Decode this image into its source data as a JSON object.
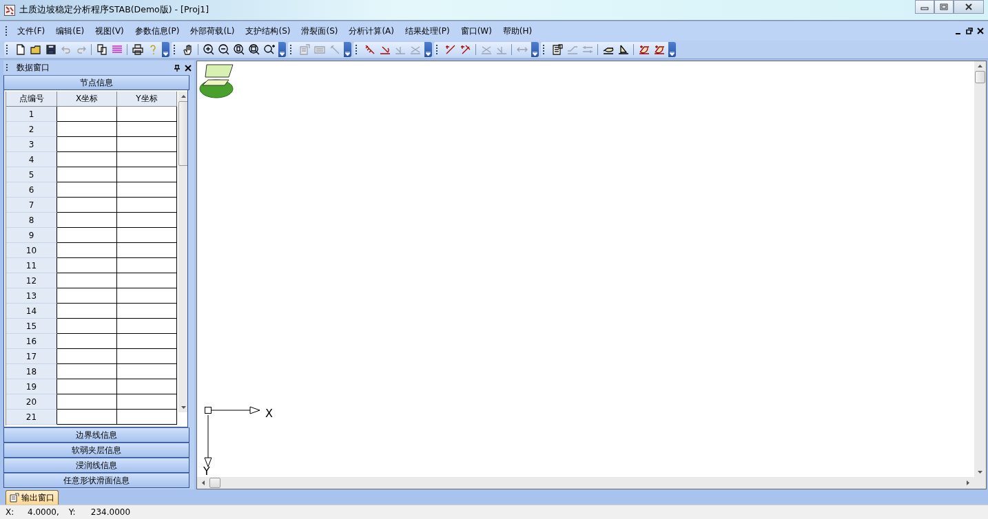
{
  "window": {
    "title": "土质边坡稳定分析程序STAB(Demo版) - [Proj1]"
  },
  "menu": [
    "文件(F)",
    "编辑(E)",
    "视图(V)",
    "参数信息(P)",
    "外部荷载(L)",
    "支护结构(S)",
    "滑裂面(S)",
    "分析计算(A)",
    "结果处理(P)",
    "窗口(W)",
    "帮助(H)"
  ],
  "toolbar_groups": [
    [
      {
        "kind": "new",
        "disabled": false
      },
      {
        "kind": "open",
        "disabled": false
      },
      {
        "kind": "save",
        "disabled": false
      },
      {
        "kind": "undo",
        "disabled": true
      },
      {
        "kind": "redo",
        "disabled": true
      },
      {
        "kind": "separator"
      },
      {
        "kind": "copy",
        "disabled": false
      },
      {
        "kind": "colors",
        "disabled": false
      },
      {
        "kind": "separator"
      },
      {
        "kind": "print",
        "disabled": false
      },
      {
        "kind": "help",
        "disabled": false
      }
    ],
    [
      {
        "kind": "hand",
        "disabled": false
      },
      {
        "kind": "separator"
      },
      {
        "kind": "zoom-in",
        "disabled": false
      },
      {
        "kind": "zoom-out",
        "disabled": false
      },
      {
        "kind": "zoom-page",
        "disabled": false
      },
      {
        "kind": "zoom-window",
        "disabled": false
      },
      {
        "kind": "zoom-plus",
        "disabled": false
      }
    ],
    [
      {
        "kind": "properties",
        "disabled": true
      },
      {
        "kind": "keyboard",
        "disabled": true
      },
      {
        "kind": "tool",
        "disabled": true
      }
    ],
    [
      {
        "kind": "hatch",
        "disabled": false
      },
      {
        "kind": "rotate",
        "disabled": false
      },
      {
        "kind": "tick-line",
        "disabled": true
      },
      {
        "kind": "cross-line",
        "disabled": true
      }
    ],
    [
      {
        "kind": "plus-line",
        "disabled": false
      },
      {
        "kind": "plus-anchor",
        "disabled": false
      },
      {
        "kind": "separator"
      },
      {
        "kind": "cross-line",
        "disabled": true
      },
      {
        "kind": "tick-line",
        "disabled": true
      },
      {
        "kind": "separator"
      },
      {
        "kind": "arrows",
        "disabled": true
      }
    ],
    [
      {
        "kind": "table",
        "disabled": false
      },
      {
        "kind": "slope",
        "disabled": true
      },
      {
        "kind": "measure",
        "disabled": true
      },
      {
        "kind": "separator"
      },
      {
        "kind": "slope-ellipse",
        "disabled": false
      },
      {
        "kind": "slope-triangle",
        "disabled": false
      },
      {
        "kind": "separator"
      },
      {
        "kind": "slip-curve",
        "disabled": false
      },
      {
        "kind": "slip-curve",
        "disabled": false
      }
    ]
  ],
  "data_window": {
    "title": "数据窗口",
    "sections": [
      {
        "title": "节点信息",
        "expanded": true
      },
      {
        "title": "边界线信息",
        "expanded": false
      },
      {
        "title": "软弱夹层信息",
        "expanded": false
      },
      {
        "title": "浸润线信息",
        "expanded": false
      },
      {
        "title": "任意形状滑面信息",
        "expanded": false
      }
    ],
    "table": {
      "columns": [
        "点编号",
        "X坐标",
        "Y坐标"
      ],
      "rows": [
        "1",
        "2",
        "3",
        "4",
        "5",
        "6",
        "7",
        "8",
        "9",
        "10",
        "11",
        "12",
        "13",
        "14",
        "15",
        "16",
        "17",
        "18",
        "19",
        "20",
        "21"
      ]
    }
  },
  "canvas": {
    "x_axis_label": "X",
    "y_axis_label": "Y"
  },
  "output_tab": {
    "label": "输出窗口"
  },
  "status_bar": [
    {
      "label": "X:",
      "value": "4.0000,"
    },
    {
      "label": "Y:",
      "value": "234.0000"
    }
  ]
}
